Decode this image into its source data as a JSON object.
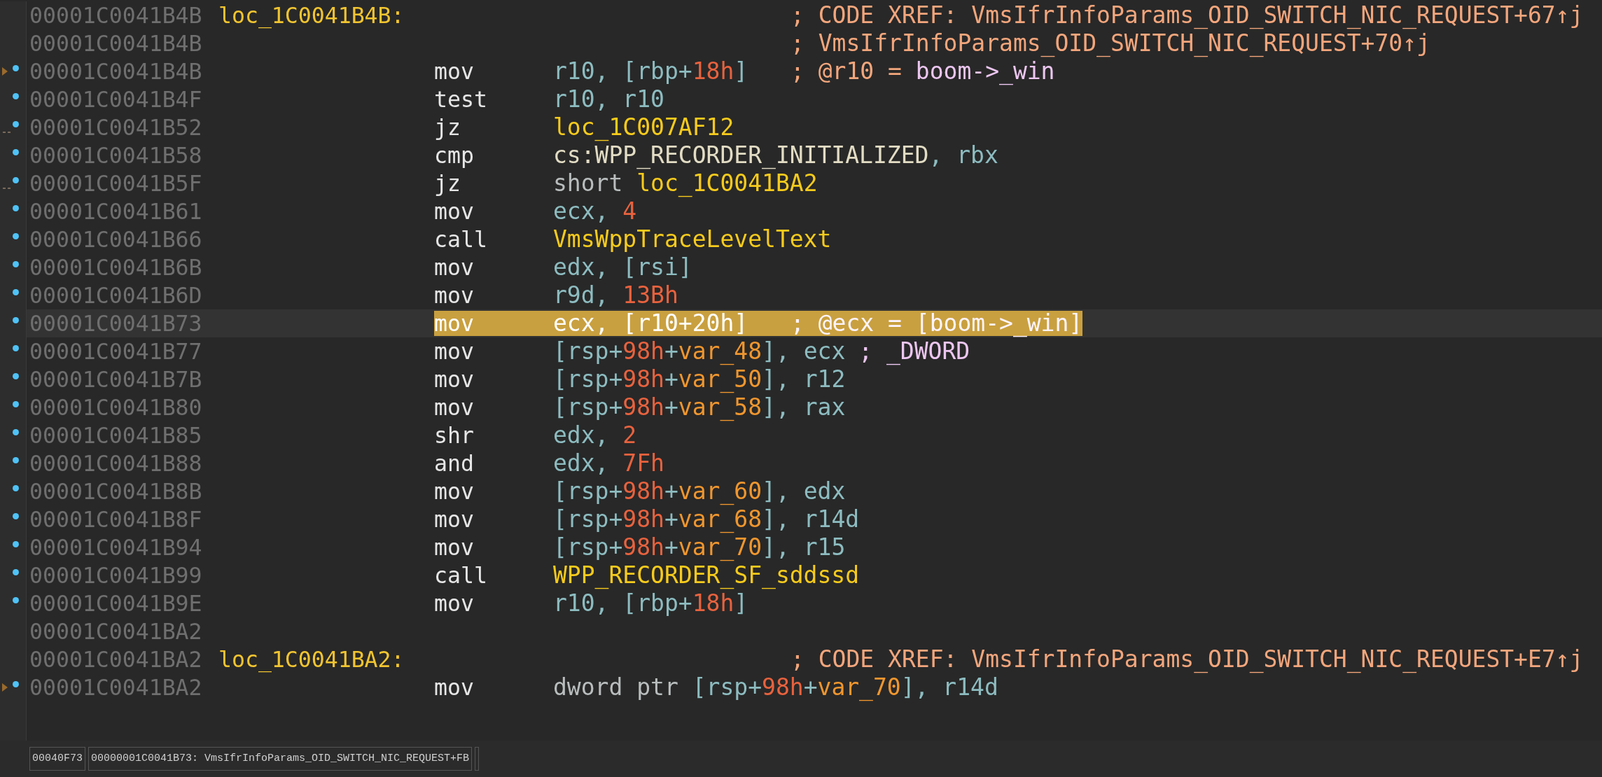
{
  "rows": [
    {
      "address": "00001C0041B4B",
      "label": "loc_1C0041B4B:",
      "comment": [
        {
          "t": "; CODE XREF: VmsIfrInfoParams_OID_SWITCH_NIC_REQUEST+67↑j",
          "kind": "cmt"
        }
      ],
      "marked": false,
      "arrow": false,
      "jump": false,
      "selected": false
    },
    {
      "address": "00001C0041B4B",
      "comment": [
        {
          "t": "; VmsIfrInfoParams_OID_SWITCH_NIC_REQUEST+70↑j",
          "kind": "cmt"
        }
      ],
      "marked": false,
      "arrow": false,
      "jump": false,
      "selected": false
    },
    {
      "address": "00001C0041B4B",
      "mnemonic": "mov",
      "operands": [
        {
          "t": "r10, [rbp+",
          "kind": "reg"
        },
        {
          "t": "18h",
          "kind": "num"
        },
        {
          "t": "]",
          "kind": "reg"
        }
      ],
      "comment": [
        {
          "t": "; @r10 = ",
          "kind": "cmt"
        },
        {
          "t": "boom->_win",
          "kind": "cmt2"
        }
      ],
      "marked": true,
      "arrow": true,
      "jump": false,
      "selected": false
    },
    {
      "address": "00001C0041B4F",
      "mnemonic": "test",
      "operands": [
        {
          "t": "r10, r10",
          "kind": "reg"
        }
      ],
      "marked": true,
      "arrow": false,
      "jump": false,
      "selected": false
    },
    {
      "address": "00001C0041B52",
      "mnemonic": "jz",
      "operands": [
        {
          "t": "loc_1C007AF12",
          "kind": "name"
        }
      ],
      "marked": true,
      "arrow": false,
      "jump": true,
      "selected": false
    },
    {
      "address": "00001C0041B58",
      "mnemonic": "cmp",
      "operands": [
        {
          "t": "cs:WPP_RECORDER_INITIALIZED",
          "kind": "sym"
        },
        {
          "t": ", rbx",
          "kind": "reg"
        }
      ],
      "marked": true,
      "arrow": false,
      "jump": false,
      "selected": false
    },
    {
      "address": "00001C0041B5F",
      "mnemonic": "jz",
      "operands": [
        {
          "t": "short ",
          "kind": "plain"
        },
        {
          "t": "loc_1C0041BA2",
          "kind": "name"
        }
      ],
      "marked": true,
      "arrow": false,
      "jump": true,
      "selected": false
    },
    {
      "address": "00001C0041B61",
      "mnemonic": "mov",
      "operands": [
        {
          "t": "ecx, ",
          "kind": "reg"
        },
        {
          "t": "4",
          "kind": "num"
        }
      ],
      "marked": true,
      "arrow": false,
      "jump": false,
      "selected": false
    },
    {
      "address": "00001C0041B66",
      "mnemonic": "call",
      "operands": [
        {
          "t": "VmsWppTraceLevelText",
          "kind": "name"
        }
      ],
      "marked": true,
      "arrow": false,
      "jump": false,
      "selected": false
    },
    {
      "address": "00001C0041B6B",
      "mnemonic": "mov",
      "operands": [
        {
          "t": "edx, [rsi]",
          "kind": "reg"
        }
      ],
      "marked": true,
      "arrow": false,
      "jump": false,
      "selected": false
    },
    {
      "address": "00001C0041B6D",
      "mnemonic": "mov",
      "operands": [
        {
          "t": "r9d, ",
          "kind": "reg"
        },
        {
          "t": "13Bh",
          "kind": "num"
        }
      ],
      "marked": true,
      "arrow": false,
      "jump": false,
      "selected": false
    },
    {
      "address": "00001C0041B73",
      "mnemonic": "mov",
      "operands": [
        {
          "t": "ecx, [r10+20h]",
          "kind": "reg"
        }
      ],
      "comment": [
        {
          "t": "; @ecx = [boom->_win]",
          "kind": "cmt2"
        }
      ],
      "marked": true,
      "arrow": false,
      "jump": false,
      "selected": true
    },
    {
      "address": "00001C0041B77",
      "mnemonic": "mov",
      "operands": [
        {
          "t": "[rsp+",
          "kind": "reg"
        },
        {
          "t": "98h",
          "kind": "num"
        },
        {
          "t": "+",
          "kind": "reg"
        },
        {
          "t": "var_48",
          "kind": "var"
        },
        {
          "t": "], ecx",
          "kind": "reg"
        }
      ],
      "comment": [
        {
          "t": "; _DWORD",
          "kind": "cmt2"
        }
      ],
      "marked": true,
      "arrow": false,
      "jump": false,
      "selected": false
    },
    {
      "address": "00001C0041B7B",
      "mnemonic": "mov",
      "operands": [
        {
          "t": "[rsp+",
          "kind": "reg"
        },
        {
          "t": "98h",
          "kind": "num"
        },
        {
          "t": "+",
          "kind": "reg"
        },
        {
          "t": "var_50",
          "kind": "var"
        },
        {
          "t": "], r12",
          "kind": "reg"
        }
      ],
      "marked": true,
      "arrow": false,
      "jump": false,
      "selected": false
    },
    {
      "address": "00001C0041B80",
      "mnemonic": "mov",
      "operands": [
        {
          "t": "[rsp+",
          "kind": "reg"
        },
        {
          "t": "98h",
          "kind": "num"
        },
        {
          "t": "+",
          "kind": "reg"
        },
        {
          "t": "var_58",
          "kind": "var"
        },
        {
          "t": "], rax",
          "kind": "reg"
        }
      ],
      "marked": true,
      "arrow": false,
      "jump": false,
      "selected": false
    },
    {
      "address": "00001C0041B85",
      "mnemonic": "shr",
      "operands": [
        {
          "t": "edx, ",
          "kind": "reg"
        },
        {
          "t": "2",
          "kind": "num"
        }
      ],
      "marked": true,
      "arrow": false,
      "jump": false,
      "selected": false
    },
    {
      "address": "00001C0041B88",
      "mnemonic": "and",
      "operands": [
        {
          "t": "edx, ",
          "kind": "reg"
        },
        {
          "t": "7Fh",
          "kind": "num"
        }
      ],
      "marked": true,
      "arrow": false,
      "jump": false,
      "selected": false
    },
    {
      "address": "00001C0041B8B",
      "mnemonic": "mov",
      "operands": [
        {
          "t": "[rsp+",
          "kind": "reg"
        },
        {
          "t": "98h",
          "kind": "num"
        },
        {
          "t": "+",
          "kind": "reg"
        },
        {
          "t": "var_60",
          "kind": "var"
        },
        {
          "t": "], edx",
          "kind": "reg"
        }
      ],
      "marked": true,
      "arrow": false,
      "jump": false,
      "selected": false
    },
    {
      "address": "00001C0041B8F",
      "mnemonic": "mov",
      "operands": [
        {
          "t": "[rsp+",
          "kind": "reg"
        },
        {
          "t": "98h",
          "kind": "num"
        },
        {
          "t": "+",
          "kind": "reg"
        },
        {
          "t": "var_68",
          "kind": "var"
        },
        {
          "t": "], r14d",
          "kind": "reg"
        }
      ],
      "marked": true,
      "arrow": false,
      "jump": false,
      "selected": false
    },
    {
      "address": "00001C0041B94",
      "mnemonic": "mov",
      "operands": [
        {
          "t": "[rsp+",
          "kind": "reg"
        },
        {
          "t": "98h",
          "kind": "num"
        },
        {
          "t": "+",
          "kind": "reg"
        },
        {
          "t": "var_70",
          "kind": "var"
        },
        {
          "t": "], r15",
          "kind": "reg"
        }
      ],
      "marked": true,
      "arrow": false,
      "jump": false,
      "selected": false
    },
    {
      "address": "00001C0041B99",
      "mnemonic": "call",
      "operands": [
        {
          "t": "WPP_RECORDER_SF_sddssd",
          "kind": "name"
        }
      ],
      "marked": true,
      "arrow": false,
      "jump": false,
      "selected": false
    },
    {
      "address": "00001C0041B9E",
      "mnemonic": "mov",
      "operands": [
        {
          "t": "r10, [rbp+",
          "kind": "reg"
        },
        {
          "t": "18h",
          "kind": "num"
        },
        {
          "t": "]",
          "kind": "reg"
        }
      ],
      "marked": true,
      "arrow": false,
      "jump": false,
      "selected": false
    },
    {
      "address": "00001C0041BA2",
      "marked": false,
      "arrow": false,
      "jump": false,
      "selected": false
    },
    {
      "address": "00001C0041BA2",
      "label": "loc_1C0041BA2:",
      "comment": [
        {
          "t": "; CODE XREF: VmsIfrInfoParams_OID_SWITCH_NIC_REQUEST+E7↑j",
          "kind": "cmt"
        }
      ],
      "marked": false,
      "arrow": false,
      "jump": false,
      "selected": false
    },
    {
      "address": "00001C0041BA2",
      "mnemonic": "mov",
      "operands": [
        {
          "t": "dword ptr ",
          "kind": "plain"
        },
        {
          "t": "[rsp+",
          "kind": "reg"
        },
        {
          "t": "98h",
          "kind": "num"
        },
        {
          "t": "+",
          "kind": "reg"
        },
        {
          "t": "var_70",
          "kind": "var"
        },
        {
          "t": "], r14d",
          "kind": "reg"
        }
      ],
      "marked": true,
      "arrow": true,
      "jump": false,
      "selected": false
    }
  ],
  "status_bar": {
    "offset": "00040F73",
    "location": "00000001C0041B73: VmsIfrInfoParams_OID_SWITCH_NIC_REQUEST+FB"
  }
}
